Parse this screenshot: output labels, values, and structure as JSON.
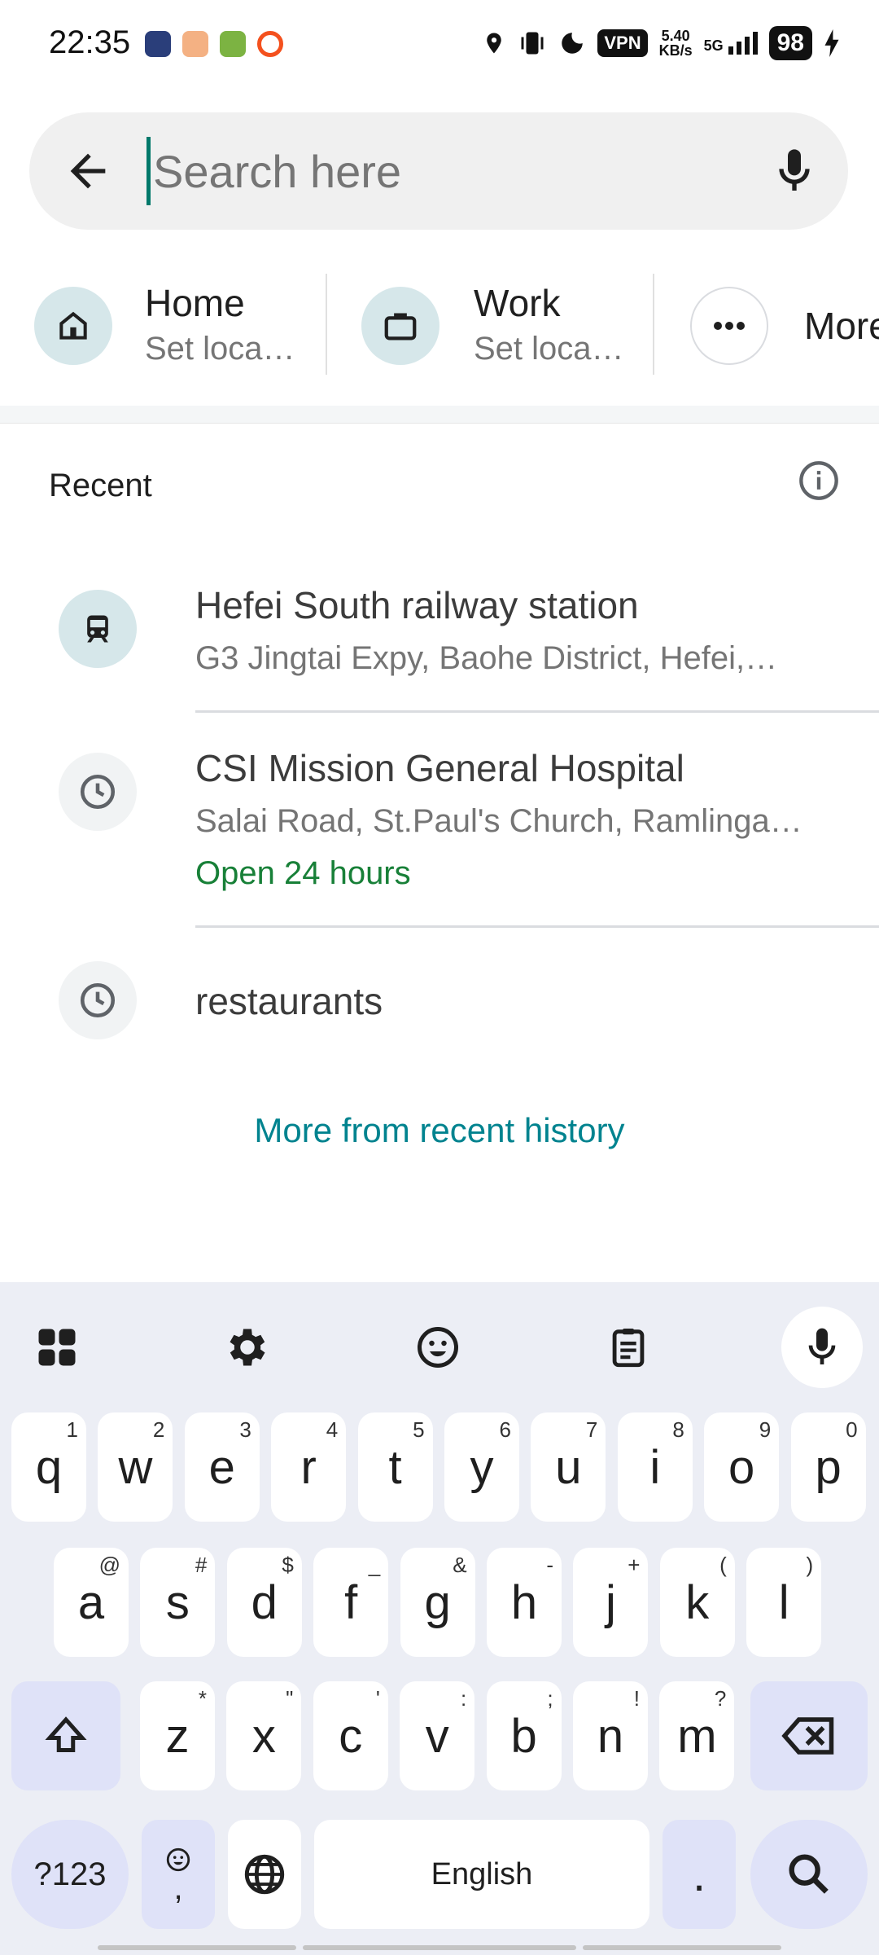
{
  "status_bar": {
    "time": "22:35",
    "vpn": "VPN",
    "net_speed_value": "5.40",
    "net_speed_unit": "KB/s",
    "network": "5G",
    "battery": "98"
  },
  "search": {
    "placeholder": "Search here",
    "value": ""
  },
  "shortcuts": [
    {
      "title": "Home",
      "subtitle": "Set loca…"
    },
    {
      "title": "Work",
      "subtitle": "Set loca…"
    },
    {
      "title": "More",
      "subtitle": ""
    }
  ],
  "recent": {
    "title": "Recent",
    "items": [
      {
        "title": "Hefei South railway station",
        "subtitle": "G3 Jingtai Expy, Baohe District, Hefei,…",
        "extra": ""
      },
      {
        "title": "CSI Mission General Hospital",
        "subtitle": "Salai Road, St.Paul's Church, Ramlinga…",
        "extra": "Open 24 hours"
      },
      {
        "title": "restaurants",
        "subtitle": "",
        "extra": ""
      }
    ],
    "more_link": "More from recent history"
  },
  "keyboard": {
    "row1": [
      {
        "k": "q",
        "h": "1"
      },
      {
        "k": "w",
        "h": "2"
      },
      {
        "k": "e",
        "h": "3"
      },
      {
        "k": "r",
        "h": "4"
      },
      {
        "k": "t",
        "h": "5"
      },
      {
        "k": "y",
        "h": "6"
      },
      {
        "k": "u",
        "h": "7"
      },
      {
        "k": "i",
        "h": "8"
      },
      {
        "k": "o",
        "h": "9"
      },
      {
        "k": "p",
        "h": "0"
      }
    ],
    "row2": [
      {
        "k": "a",
        "h": "@"
      },
      {
        "k": "s",
        "h": "#"
      },
      {
        "k": "d",
        "h": "$"
      },
      {
        "k": "f",
        "h": "_"
      },
      {
        "k": "g",
        "h": "&"
      },
      {
        "k": "h",
        "h": "-"
      },
      {
        "k": "j",
        "h": "+"
      },
      {
        "k": "k",
        "h": "("
      },
      {
        "k": "l",
        "h": ")"
      }
    ],
    "row3": [
      {
        "k": "z",
        "h": "*"
      },
      {
        "k": "x",
        "h": "\""
      },
      {
        "k": "c",
        "h": "'"
      },
      {
        "k": "v",
        "h": ":"
      },
      {
        "k": "b",
        "h": ";"
      },
      {
        "k": "n",
        "h": "!"
      },
      {
        "k": "m",
        "h": "?"
      }
    ],
    "symbols_label": "?123",
    "comma_label": ",",
    "space_label": "English",
    "period_label": "."
  },
  "colors": {
    "accent": "#00838f",
    "open_green": "#188038",
    "icon_bg": "#d6e7ea",
    "keyboard_bg": "#eceef5"
  }
}
